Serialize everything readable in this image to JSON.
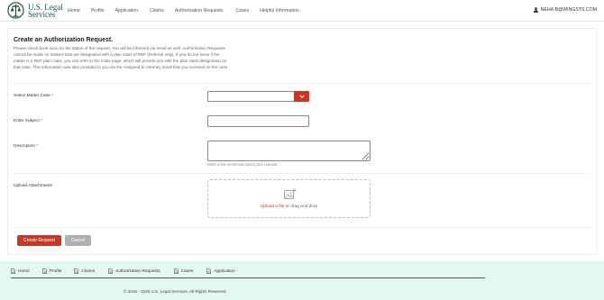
{
  "brand": {
    "line1": "U.S. Legal",
    "line2": "Services"
  },
  "nav": [
    "Home",
    "Profile",
    "Application",
    "Claims",
    "Authorization Requests",
    "Cases",
    "Helpful Information"
  ],
  "user": {
    "email": "NEHA.B@WINGSTS.COM",
    "icon": "user-icon"
  },
  "page": {
    "title": "Create an Authorization Request.",
    "intro": "Please check back soon for the status of the request. You will be informed via email as well. Authorization Requests cannot be made on matters that are designated with a plan class of REF (Referral only). If you do not know if the matter is a REF plan class, you can refer to the Case page, which will provide you with the plan class designation on that case. This information was also provided to you via the Assigned to Attorney email that you received on the case."
  },
  "form": {
    "matter_label": "Select Matter Case",
    "subject_label": "Enter Subject",
    "description_label": "Description",
    "description_hint": "Write a few sentences about your request.",
    "attachments_label": "Upload Attachments",
    "upload_link": "Upload a file",
    "upload_rest": " or drag and drop",
    "required_mark": "*"
  },
  "buttons": {
    "submit": "Create Request",
    "cancel": "Cancel"
  },
  "footer": {
    "links": [
      "Home",
      "Profile",
      "Claims",
      "Authorization Requests",
      "Cases",
      "Application"
    ],
    "copyright": "© 2016 - 2026 U.S. Legal Services. All Rights Reserved."
  },
  "colors": {
    "accent": "#c0392b",
    "brand": "#1e4a4a",
    "footer_bg": "#e3f7f3"
  }
}
